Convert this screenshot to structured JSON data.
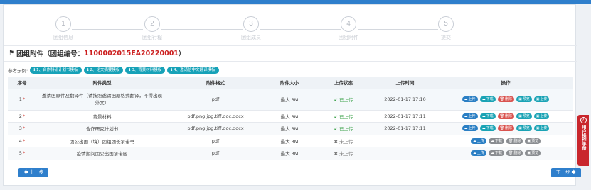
{
  "steps": [
    {
      "num": "1",
      "label": "团组信息"
    },
    {
      "num": "2",
      "label": "团组行程"
    },
    {
      "num": "3",
      "label": "团组成员"
    },
    {
      "num": "4",
      "label": "团组附件"
    },
    {
      "num": "5",
      "label": "提交"
    }
  ],
  "section": {
    "title_prefix": "团组附件（团组编号：",
    "group_no": "1100002015EA20220001",
    "title_suffix": "）"
  },
  "references": {
    "label": "参考示例:",
    "items": [
      "1、合作科研计划书模板",
      "2、论文摘要模板",
      "3、背景材料模板",
      "4、邀请信中文翻译模板"
    ]
  },
  "table": {
    "headers": [
      "序号",
      "附件类型",
      "附件格式",
      "附件大小",
      "上传状态",
      "上传时间",
      "操作"
    ],
    "rows": [
      {
        "no": "1",
        "type": "邀请函原件及翻译件（请按照邀请函原格式翻译，不得出现外文）",
        "format": "pdf",
        "size": "最大 3M",
        "status": "已上传",
        "time": "2022-01-17 17:10",
        "uploaded": true,
        "previews": [
          "预览",
          "上传"
        ]
      },
      {
        "no": "2",
        "type": "背景材料",
        "format": "pdf,png,jpg,tiff,doc,docx",
        "size": "最大 3M",
        "status": "已上传",
        "time": "2022-01-17 17:11",
        "uploaded": true,
        "previews": [
          "预览",
          "上传"
        ]
      },
      {
        "no": "3",
        "type": "合作研究计划书",
        "format": "pdf,png,jpg,tiff,doc,docx",
        "size": "最大 3M",
        "status": "已上传",
        "time": "2022-01-17 17:11",
        "uploaded": true,
        "previews": [
          "预览",
          "上传"
        ]
      },
      {
        "no": "4",
        "type": "因公出国（境）团组团长承诺书",
        "format": "pdf",
        "size": "最大 3M",
        "status": "未上传",
        "time": "",
        "uploaded": false,
        "previews": [
          "预览"
        ]
      },
      {
        "no": "5",
        "type": "疫情期间因公出国承诺函",
        "format": "pdf",
        "size": "最大 3M",
        "status": "未上传",
        "time": "",
        "uploaded": false,
        "previews": [
          "预览"
        ]
      }
    ],
    "actions": {
      "upload": "上传",
      "download": "下载",
      "delete": "删除"
    }
  },
  "nav": {
    "prev": "上一步",
    "next": "下一步"
  },
  "help": {
    "icon": "?",
    "text": "用户操作手册"
  }
}
